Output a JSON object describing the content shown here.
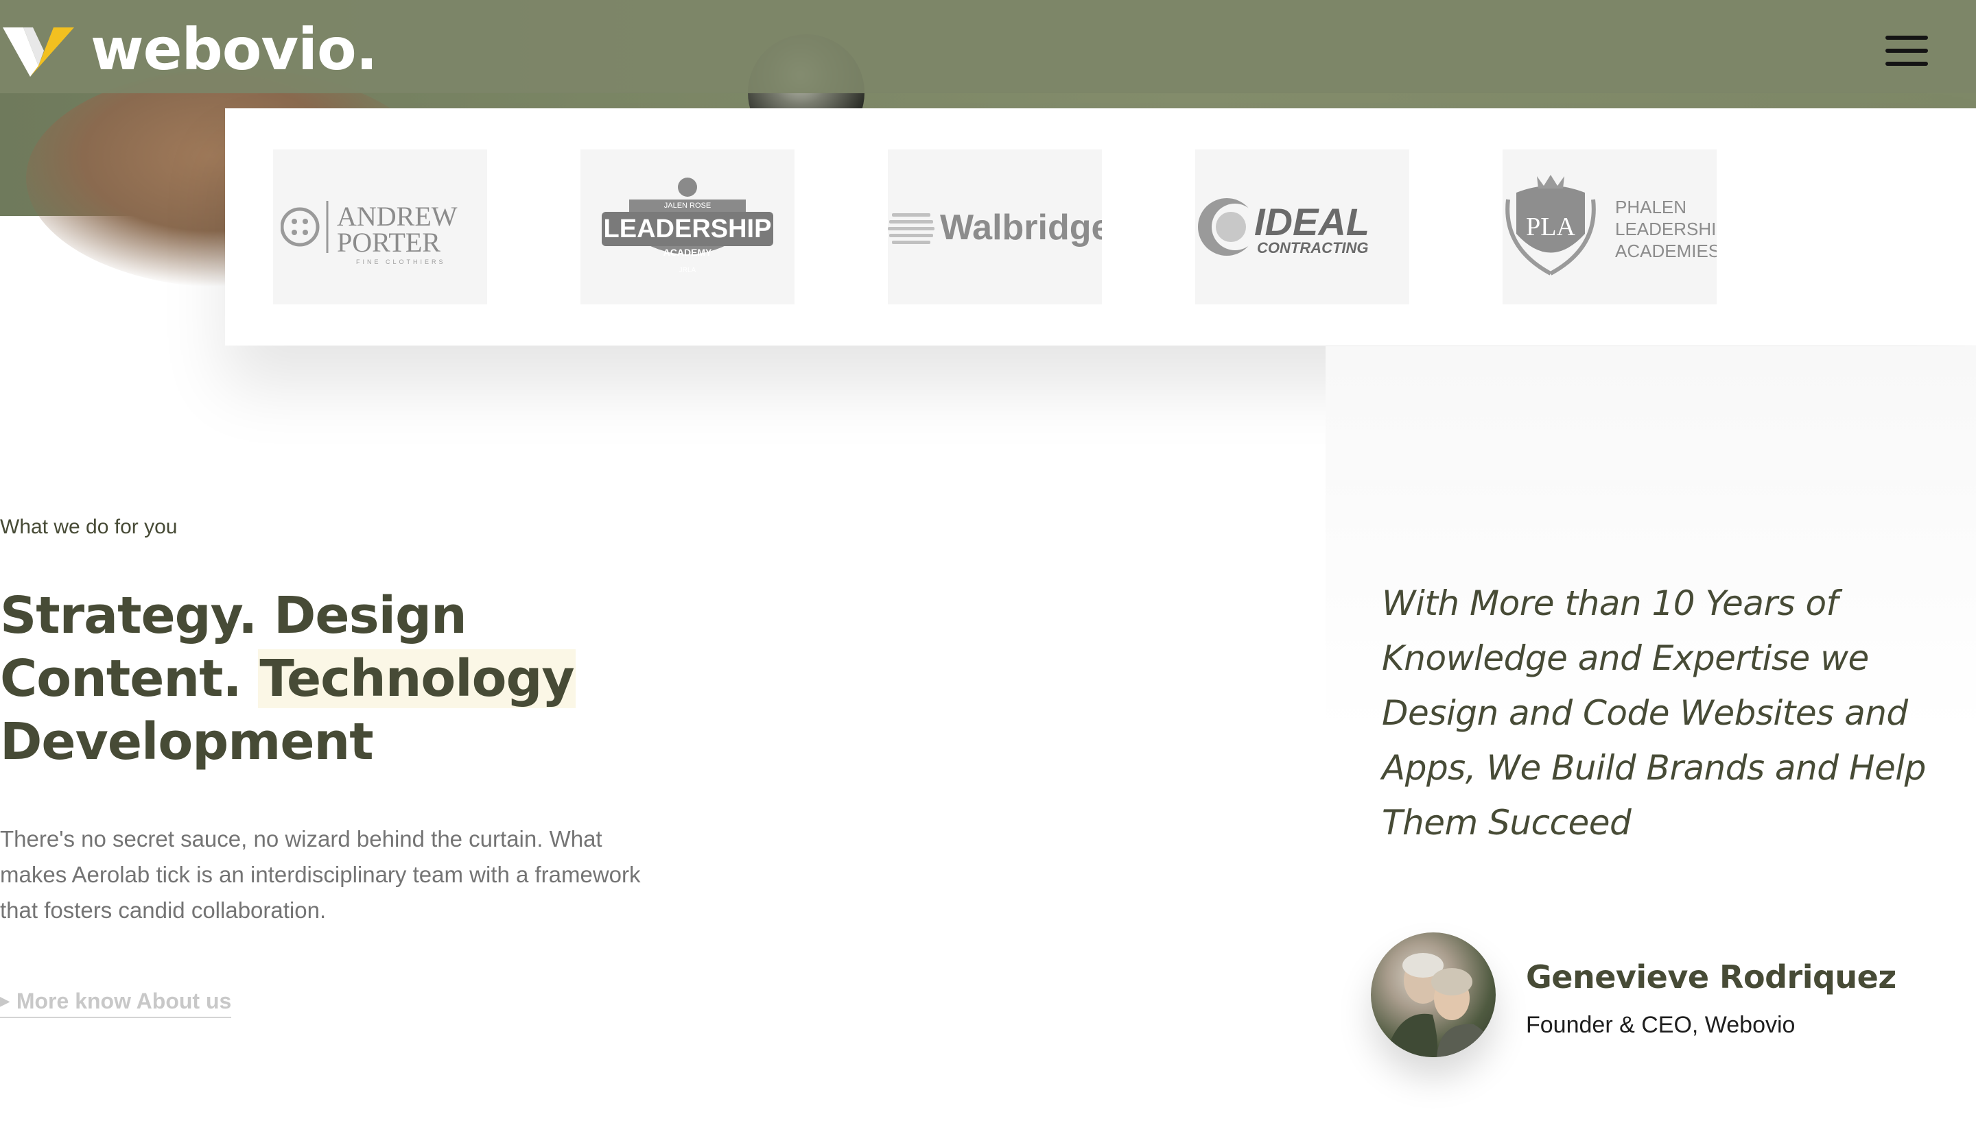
{
  "header": {
    "brand": "webovio.",
    "logo_icon": "webovio-v-mark",
    "menu_icon": "hamburger-icon"
  },
  "clients": [
    {
      "name": "ANDREW PORTER",
      "line1": "ANDREW",
      "line2": "PORTER",
      "tagline": "FINE CLOTHIERS"
    },
    {
      "name": "LEADERSHIP",
      "top": "JALEN ROSE",
      "main": "LEADERSHIP",
      "sub": "ACADEMY",
      "badge": "JRLA"
    },
    {
      "name": "Walbridge"
    },
    {
      "name": "IDEAL CONTRACTING",
      "main": "IDEAL",
      "sub": "CONTRACTING"
    },
    {
      "name": "PHALEN LEADERSHIP ACADEMIES",
      "line1": "PHALEN",
      "line2": "LEADERSHIP",
      "line3": "ACADEMIES",
      "crest": "PLA"
    }
  ],
  "about": {
    "eyebrow": "What we do for you",
    "heading_line1": "Strategy. Design",
    "heading_line2a": "Content. ",
    "heading_line2b": "Technology",
    "heading_line3": "Development",
    "body": "There's no secret sauce, no wizard behind the curtain. What makes Aerolab tick is an interdisciplinary team with a framework that fosters candid collaboration.",
    "link_label": "More know About us"
  },
  "testimonial": {
    "quote": "With More than 10 Years of Knowledge and Expertise we Design and Code Websites and Apps, We Build Brands and Help Them Succeed",
    "author_name": "Genevieve Rodriquez",
    "author_role": "Founder & CEO, Webovio"
  },
  "colors": {
    "primary_text": "#474b36",
    "header_bg": "#7d8568",
    "highlight": "#fbf7e6",
    "muted_link": "#c8c8c8"
  }
}
